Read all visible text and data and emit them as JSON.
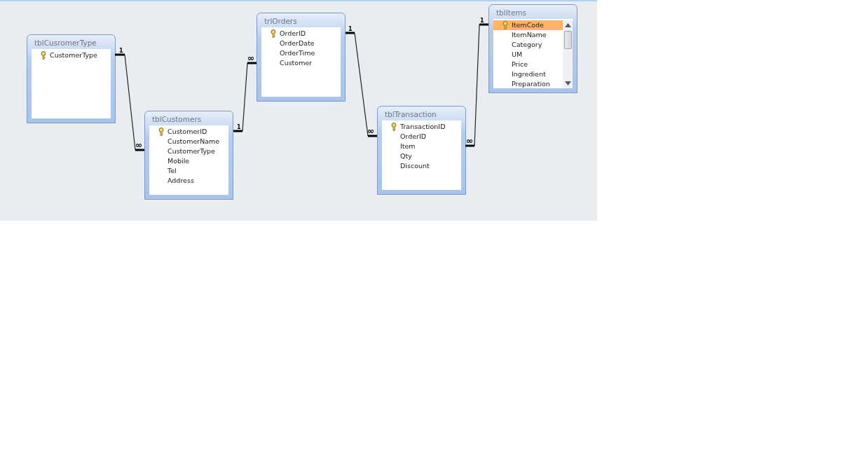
{
  "tables": [
    {
      "title": "tblCusromerType",
      "fields": [
        {
          "name": "CustomerType",
          "key": true,
          "selected": false
        }
      ]
    },
    {
      "title": "tblCustomers",
      "fields": [
        {
          "name": "CustomerID",
          "key": true,
          "selected": false
        },
        {
          "name": "CustomerName",
          "key": false,
          "selected": false
        },
        {
          "name": "CustomerType",
          "key": false,
          "selected": false
        },
        {
          "name": "Mobile",
          "key": false,
          "selected": false
        },
        {
          "name": "Tel",
          "key": false,
          "selected": false
        },
        {
          "name": "Address",
          "key": false,
          "selected": false
        }
      ]
    },
    {
      "title": "trlOrders",
      "fields": [
        {
          "name": "OrderID",
          "key": true,
          "selected": false
        },
        {
          "name": "OrderDate",
          "key": false,
          "selected": false
        },
        {
          "name": "OrderTime",
          "key": false,
          "selected": false
        },
        {
          "name": "Customer",
          "key": false,
          "selected": false
        }
      ]
    },
    {
      "title": "tblTransaction",
      "fields": [
        {
          "name": "TransactionID",
          "key": true,
          "selected": false
        },
        {
          "name": "OrderID",
          "key": false,
          "selected": false
        },
        {
          "name": "Item",
          "key": false,
          "selected": false
        },
        {
          "name": "Qty",
          "key": false,
          "selected": false
        },
        {
          "name": "Discount",
          "key": false,
          "selected": false
        }
      ]
    },
    {
      "title": "tblItems",
      "scrollbar": true,
      "fields": [
        {
          "name": "ItemCode",
          "key": true,
          "selected": true
        },
        {
          "name": "ItemName",
          "key": false,
          "selected": false
        },
        {
          "name": "Category",
          "key": false,
          "selected": false
        },
        {
          "name": "UM",
          "key": false,
          "selected": false
        },
        {
          "name": "Price",
          "key": false,
          "selected": false
        },
        {
          "name": "Ingredient",
          "key": false,
          "selected": false
        },
        {
          "name": "Preparation",
          "key": false,
          "selected": false
        }
      ]
    }
  ],
  "relationships": [
    {
      "one_label": "1",
      "many_label": "∞"
    },
    {
      "one_label": "1",
      "many_label": "∞"
    },
    {
      "one_label": "1",
      "many_label": "∞"
    },
    {
      "one_label": "1",
      "many_label": "∞"
    }
  ]
}
